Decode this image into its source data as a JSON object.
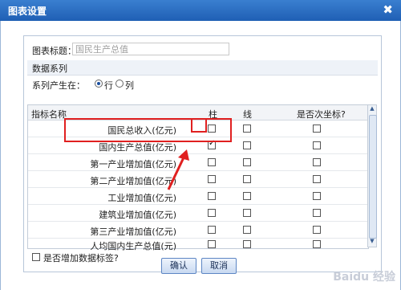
{
  "window": {
    "title": "图表设置",
    "close_label": "✖"
  },
  "chart_title": {
    "label": "图表标题：",
    "value": "国民生产总值"
  },
  "series_section": {
    "label": "数据系列"
  },
  "series_mode": {
    "label": "系列产生在：",
    "options": [
      {
        "label": "行",
        "selected": true
      },
      {
        "label": "列",
        "selected": false
      }
    ]
  },
  "grid": {
    "columns": {
      "name": "指标名称",
      "bar": "柱",
      "line": "线",
      "secondary_axis": "是否次坐标?"
    },
    "rows": [
      {
        "name": "国民总收入(亿元)",
        "bar": false,
        "line": false,
        "secondary": false
      },
      {
        "name": "国内生产总值(亿元)",
        "bar": true,
        "line": false,
        "secondary": false
      },
      {
        "name": "第一产业增加值(亿元)",
        "bar": false,
        "line": false,
        "secondary": false
      },
      {
        "name": "第二产业增加值(亿元)",
        "bar": false,
        "line": false,
        "secondary": false
      },
      {
        "name": "工业增加值(亿元)",
        "bar": false,
        "line": false,
        "secondary": false
      },
      {
        "name": "建筑业增加值(亿元)",
        "bar": false,
        "line": false,
        "secondary": false
      },
      {
        "name": "第三产业增加值(亿元)",
        "bar": false,
        "line": false,
        "secondary": false
      },
      {
        "name": "人均国内生产总值(元)",
        "bar": false,
        "line": false,
        "secondary": false
      }
    ]
  },
  "data_labels": {
    "label": "是否增加数据标签?",
    "checked": false
  },
  "buttons": {
    "ok": "确认",
    "cancel": "取消"
  },
  "watermark": "Baidu 经验",
  "colors": {
    "titlebar": "#2a6cc4",
    "highlight": "#e02020"
  }
}
